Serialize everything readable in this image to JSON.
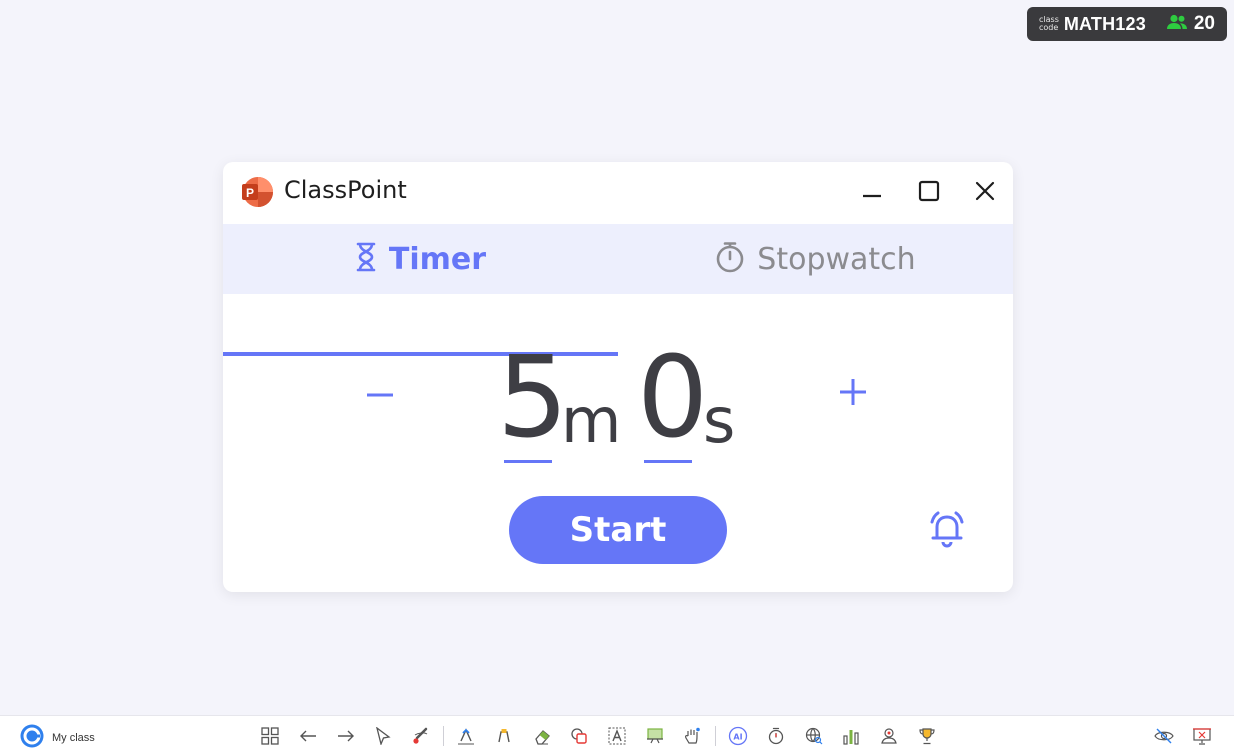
{
  "badge": {
    "small_line1": "class",
    "small_line2": "code",
    "code": "MATH123",
    "participants": "20",
    "participants_icon": "people-icon",
    "participants_color": "#2ECC40"
  },
  "window": {
    "title": "ClassPoint",
    "app_icon": "powerpoint-icon",
    "controls": [
      "minimize-icon",
      "maximize-icon",
      "close-icon"
    ]
  },
  "tabs": [
    {
      "label": "Timer",
      "icon": "hourglass-icon",
      "active": true
    },
    {
      "label": "Stopwatch",
      "icon": "stopwatch-icon",
      "active": false
    }
  ],
  "timer": {
    "minutes": "5",
    "minutes_unit": "m",
    "seconds": "0",
    "seconds_unit": "s",
    "decrement_icon": "minus-icon",
    "increment_icon": "plus-icon",
    "start_label": "Start",
    "sound_icon": "bell-icon"
  },
  "toolbar": {
    "class_label": "My class",
    "class_icon": "classpoint-logo-icon",
    "tools": [
      "grid-icon",
      "arrow-left-icon",
      "arrow-right-icon",
      "pointer-icon",
      "laser-pen-icon",
      "pen-icon",
      "highlighter-icon",
      "eraser-icon",
      "shapes-icon",
      "textbox-icon",
      "whiteboard-icon",
      "hand-icon",
      "ai-icon",
      "timer-icon",
      "web-search-icon",
      "chart-icon",
      "name-picker-icon",
      "trophy-icon",
      "hide-icon",
      "end-slideshow-icon"
    ]
  },
  "colors": {
    "accent": "#6576F7",
    "background": "#F4F4FB",
    "tab_bar": "#EDEFFD",
    "badge_bg": "#3A3A3D"
  }
}
